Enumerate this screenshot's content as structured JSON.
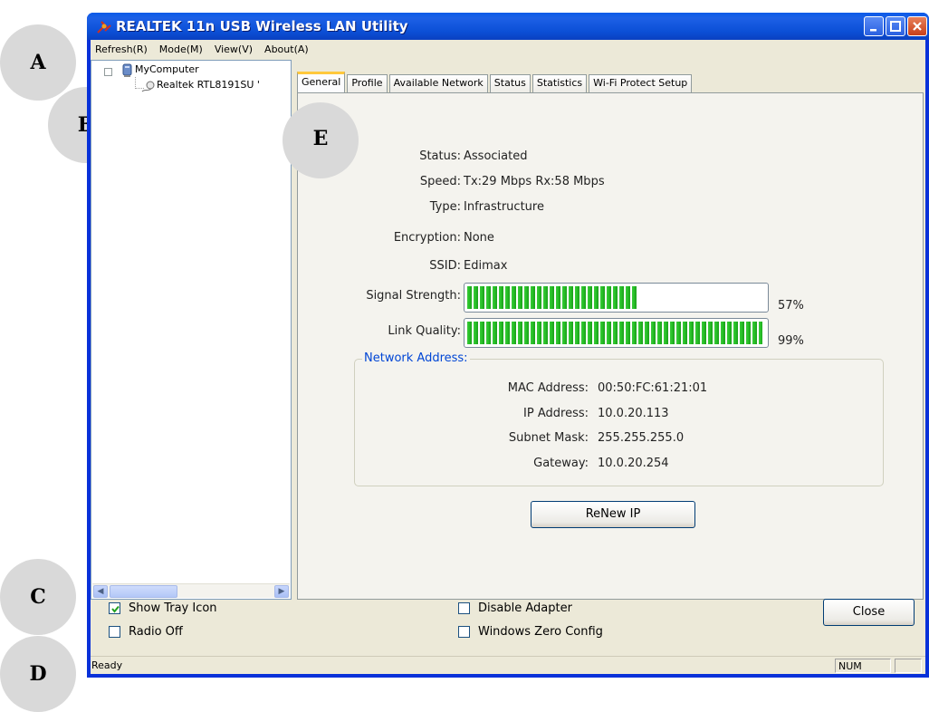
{
  "callouts": [
    "A",
    "B",
    "C",
    "D",
    "E"
  ],
  "window": {
    "title": "REALTEK 11n USB Wireless LAN Utility"
  },
  "menu": [
    "Refresh(R)",
    "Mode(M)",
    "View(V)",
    "About(A)"
  ],
  "tree": {
    "root": "MyComputer",
    "expander": "⊟",
    "child": "Realtek RTL8191SU '"
  },
  "tabs": [
    "General",
    "Profile",
    "Available Network",
    "Status",
    "Statistics",
    "Wi-Fi Protect Setup"
  ],
  "active_tab": "General",
  "general": {
    "status_label": "Status:",
    "status_value": "Associated",
    "speed_label": "Speed:",
    "speed_value": "Tx:29 Mbps Rx:58 Mbps",
    "type_label": "Type:",
    "type_value": "Infrastructure",
    "encryption_label": "Encryption:",
    "encryption_value": "None",
    "ssid_label": "SSID:",
    "ssid_value": "Edimax",
    "signal_label": "Signal Strength:",
    "signal_value": 57,
    "signal_text": "57%",
    "link_label": "Link Quality:",
    "link_value": 99,
    "link_text": "99%"
  },
  "network_address": {
    "title": "Network Address:",
    "mac_label": "MAC Address:",
    "mac_value": "00:50:FC:61:21:01",
    "ip_label": "IP Address:",
    "ip_value": "10.0.20.113",
    "subnet_label": "Subnet Mask:",
    "subnet_value": "255.255.255.0",
    "gateway_label": "Gateway:",
    "gateway_value": "10.0.20.254"
  },
  "renew_button": "ReNew IP",
  "options": {
    "show_tray_icon": "Show Tray Icon",
    "show_tray_icon_checked": true,
    "radio_off": "Radio Off",
    "disable_adapter": "Disable Adapter",
    "windows_zero_config": "Windows Zero Config"
  },
  "close_button": "Close",
  "status_bar": {
    "text": "Ready",
    "num": "NUM"
  },
  "colors": {
    "title_bar": "#0a5be8",
    "progress_green": "#2fcc2f",
    "group_title": "#0046d5"
  }
}
